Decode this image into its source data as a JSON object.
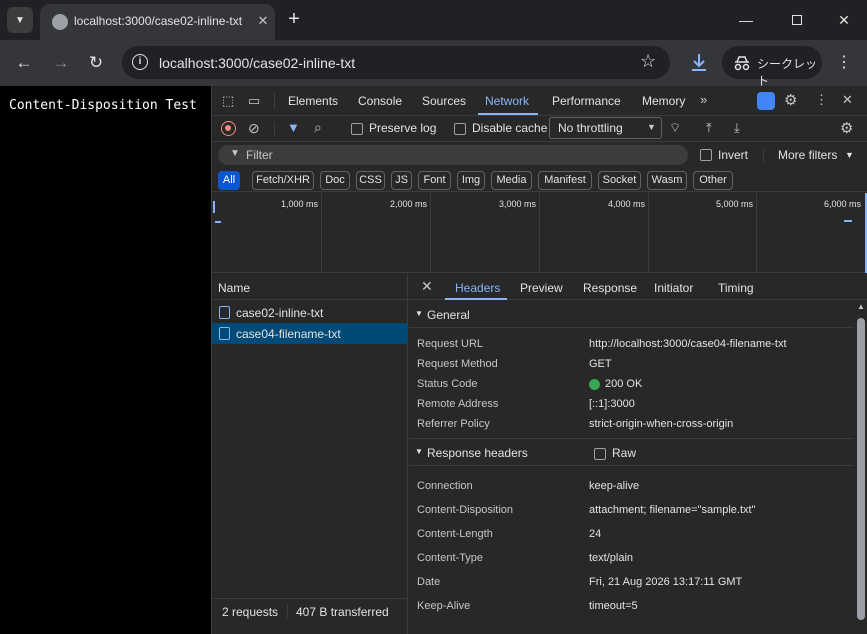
{
  "browser": {
    "tab_title": "localhost:3000/case02-inline-txt",
    "url": "localhost:3000/case02-inline-txt",
    "incognito_label": "シークレット"
  },
  "page": {
    "text": "Content-Disposition Test"
  },
  "devtools": {
    "tabs": [
      "Elements",
      "Console",
      "Sources",
      "Network",
      "Performance",
      "Memory"
    ],
    "active_tab": "Network",
    "toolbar": {
      "preserve_log": "Preserve log",
      "disable_cache": "Disable cache",
      "throttling": "No throttling"
    },
    "filter": {
      "placeholder": "Filter",
      "invert": "Invert",
      "more_filters": "More filters"
    },
    "type_filters": [
      "All",
      "Fetch/XHR",
      "Doc",
      "CSS",
      "JS",
      "Font",
      "Img",
      "Media",
      "Manifest",
      "Socket",
      "Wasm",
      "Other"
    ],
    "timeline_labels": [
      "1,000 ms",
      "2,000 ms",
      "3,000 ms",
      "4,000 ms",
      "5,000 ms",
      "6,000 ms"
    ],
    "name_header": "Name",
    "requests": [
      {
        "name": "case02-inline-txt",
        "selected": false
      },
      {
        "name": "case04-filename-txt",
        "selected": true
      }
    ],
    "status": {
      "requests": "2 requests",
      "transferred": "407 B transferred"
    },
    "detail_tabs": [
      "Headers",
      "Preview",
      "Response",
      "Initiator",
      "Timing"
    ],
    "active_detail_tab": "Headers",
    "general": {
      "title": "General",
      "rows": [
        {
          "key": "Request URL",
          "value": "http://localhost:3000/case04-filename-txt"
        },
        {
          "key": "Request Method",
          "value": "GET"
        },
        {
          "key": "Status Code",
          "value": "200 OK"
        },
        {
          "key": "Remote Address",
          "value": "[::1]:3000"
        },
        {
          "key": "Referrer Policy",
          "value": "strict-origin-when-cross-origin"
        }
      ]
    },
    "response_headers": {
      "title": "Response headers",
      "raw_label": "Raw",
      "rows": [
        {
          "key": "Connection",
          "value": "keep-alive"
        },
        {
          "key": "Content-Disposition",
          "value": "attachment; filename=\"sample.txt\""
        },
        {
          "key": "Content-Length",
          "value": "24"
        },
        {
          "key": "Content-Type",
          "value": "text/plain"
        },
        {
          "key": "Date",
          "value": "Fri, 21 Aug 2026 13:17:11 GMT"
        },
        {
          "key": "Keep-Alive",
          "value": "timeout=5"
        }
      ]
    },
    "colors": {
      "accent": "#8ab4f8",
      "selected_row": "#004a77",
      "status_ok": "#34a853",
      "record_red": "#f28b82"
    }
  }
}
